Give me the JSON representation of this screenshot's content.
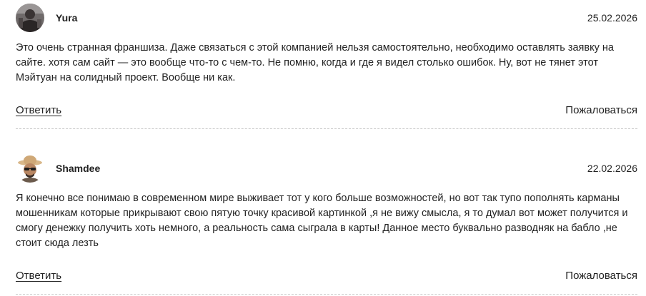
{
  "comments": [
    {
      "author": "Yura",
      "date": "25.02.2026",
      "avatar_icon": "user-avatar-dark",
      "text": "Это очень странная франшиза. Даже связаться с этой компанией нельзя самостоятельно, необходимо оставлять заявку на сайте. хотя сам сайт — это вообще что-то с чем-то. Не помню, когда и где я видел столько ошибок. Ну, вот не тянет этот Мэйтуан на солидный проект. Вообще ни как.",
      "reply_label": "Ответить",
      "report_label": "Пожаловаться"
    },
    {
      "author": "Shamdee",
      "date": "22.02.2026",
      "avatar_icon": "user-avatar-hat-sunglasses",
      "text": "Я конечно все понимаю в современном мире выживает тот у кого больше возможностей, но вот так тупо пополнять карманы мошенникам которые прикрывают свою пятую точку красивой картинкой ,я не вижу смысла, я то думал вот может получится и смогу денежку получить хоть немного, а реальность сама сыграла в карты! Данное место буквально разводняк на бабло ,не стоит сюда лезть",
      "reply_label": "Ответить",
      "report_label": "Пожаловаться"
    }
  ]
}
